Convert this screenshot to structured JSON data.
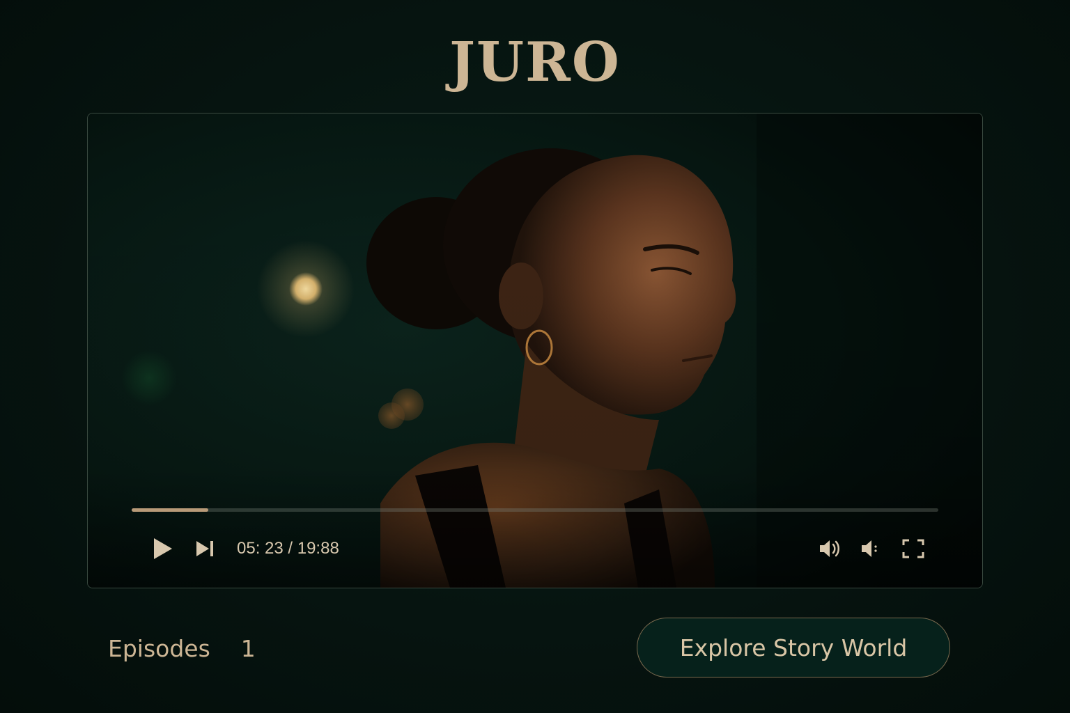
{
  "app": {
    "title": "JURO"
  },
  "player": {
    "time_display": "05: 23 / 19:88",
    "progress_fraction": 0.095,
    "controls": {
      "play": "play-icon",
      "next": "skip-next-icon",
      "volume": "volume-icon",
      "mute": "volume-low-icon",
      "fullscreen": "fullscreen-icon"
    }
  },
  "footer": {
    "episodes_label": "Episodes",
    "episodes_count": "1",
    "explore_button": "Explore Story World"
  },
  "colors": {
    "accent": "#cdb695",
    "background": "#071410",
    "progress": "#b89a78"
  }
}
